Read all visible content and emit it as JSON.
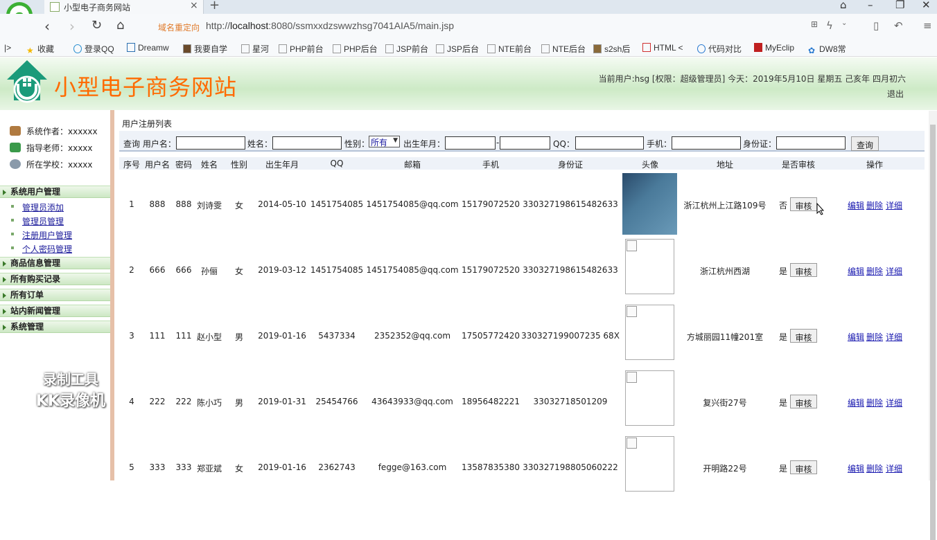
{
  "browser": {
    "tab_title": "小型电子商务网站",
    "redirect_label": "域名重定向",
    "url_prefix": "http://",
    "url_host": "localhost",
    "url_rest": ":8080/ssmxxdzswwzhsg7041AIA5/main.jsp",
    "bookmarks": [
      "收藏",
      "登录QQ",
      "Dreamw",
      "我要自学",
      "星河",
      "PHP前台",
      "PHP后台",
      "JSP前台",
      "JSP后台",
      "NTE前台",
      "NTE后台",
      "s2sh后",
      "HTML <",
      "代码对比",
      "MyEclip",
      "DW8常"
    ]
  },
  "header": {
    "title": "小型电子商务网站",
    "user_info": "当前用户:hsg [权限：超级管理员] 今天：2019年5月10日 星期五 己亥年 四月初六",
    "logout": "退出"
  },
  "sidebar": {
    "info": [
      "系统作者：xxxxxx",
      "指导老师：xxxxx",
      "所在学校：xxxxx"
    ],
    "menus": [
      {
        "label": "系统用户管理",
        "items": [
          "管理员添加",
          "管理员管理",
          "注册用户管理",
          "个人密码管理"
        ]
      },
      {
        "label": "商品信息管理",
        "items": []
      },
      {
        "label": "所有购买记录",
        "items": []
      },
      {
        "label": "所有订单",
        "items": []
      },
      {
        "label": "站内新闻管理",
        "items": []
      },
      {
        "label": "系统管理",
        "items": []
      }
    ],
    "watermark": [
      "录制工具",
      "KK录像机"
    ]
  },
  "main": {
    "heading": "用户注册列表",
    "search": {
      "prefix": "查询 用户名：",
      "name_label": "姓名：",
      "gender_label": "性别：",
      "gender_value": "所有",
      "birth_label": "出生年月：",
      "birth_sep": "-",
      "qq_label": "QQ：",
      "phone_label": "手机：",
      "idcard_label": "身份证：",
      "query_button": "查询"
    },
    "columns": [
      "序号",
      "用户名",
      "密码",
      "姓名",
      "性别",
      "出生年月",
      "QQ",
      "邮箱",
      "手机",
      "身份证",
      "头像",
      "地址",
      "是否审核",
      "操作"
    ],
    "rows": [
      {
        "no": "1",
        "user": "888",
        "pwd": "888",
        "name": "刘诗雯",
        "gender": "女",
        "birth": "2014-05-10",
        "qq": "1451754085",
        "email": "1451754085@qq.com",
        "phone": "15179072520",
        "idcard": "330327198615482633",
        "address": "浙江杭州上江路109号",
        "audited": "否"
      },
      {
        "no": "2",
        "user": "666",
        "pwd": "666",
        "name": "孙俪",
        "gender": "女",
        "birth": "2019-03-12",
        "qq": "1451754085",
        "email": "1451754085@qq.com",
        "phone": "15179072520",
        "idcard": "330327198615482633",
        "address": "浙江杭州西湖",
        "audited": "是"
      },
      {
        "no": "3",
        "user": "111",
        "pwd": "111",
        "name": "赵小型",
        "gender": "男",
        "birth": "2019-01-16",
        "qq": "5437334",
        "email": "2352352@qq.com",
        "phone": "17505772420",
        "idcard": "330327199007235 68X",
        "address": "方城丽园11幢201室",
        "audited": "是"
      },
      {
        "no": "4",
        "user": "222",
        "pwd": "222",
        "name": "陈小巧",
        "gender": "男",
        "birth": "2019-01-31",
        "qq": "25454766",
        "email": "43643933@qq.com",
        "phone": "18956482221",
        "idcard": "33032718501209",
        "address": "复兴街27号",
        "audited": "是"
      },
      {
        "no": "5",
        "user": "333",
        "pwd": "333",
        "name": "郑亚斌",
        "gender": "女",
        "birth": "2019-01-16",
        "qq": "2362743",
        "email": "fegge@163.com",
        "phone": "13587835380",
        "idcard": "330327198805060222",
        "address": "开明路22号",
        "audited": "是"
      }
    ],
    "audit_button": "审核",
    "ops": {
      "edit": "编辑",
      "delete": "删除",
      "detail": "详细"
    }
  }
}
